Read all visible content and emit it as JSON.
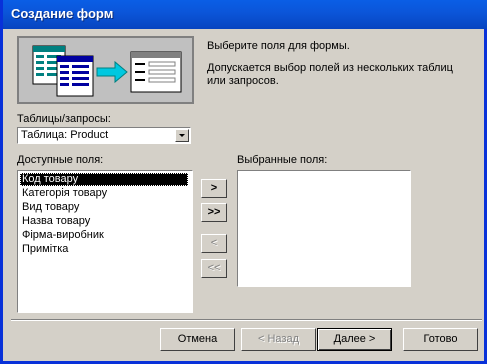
{
  "window": {
    "title": "Создание форм"
  },
  "intro": {
    "line1": "Выберите поля для формы.",
    "line2": "Допускается выбор полей из нескольких таблиц или запросов."
  },
  "tables": {
    "label": "Таблицы/запросы:",
    "selected": "Таблица: Product"
  },
  "available": {
    "label": "Доступные поля:",
    "items": [
      "Код товару",
      "Категорія товару",
      "Вид товару",
      "Назва товару",
      "Фірма-виробник",
      "Примітка"
    ],
    "selected_index": 0
  },
  "chosen": {
    "label": "Выбранные поля:",
    "items": []
  },
  "move": {
    "one": ">",
    "all": ">>",
    "back_one": "<",
    "back_all": "<<"
  },
  "footer": {
    "cancel": "Отмена",
    "back": "< Назад",
    "next": "Далее >",
    "finish": "Готово"
  },
  "colors": {
    "titlebar": "#0a5ee6",
    "face": "#d4d0c8",
    "selection": "#000000"
  }
}
